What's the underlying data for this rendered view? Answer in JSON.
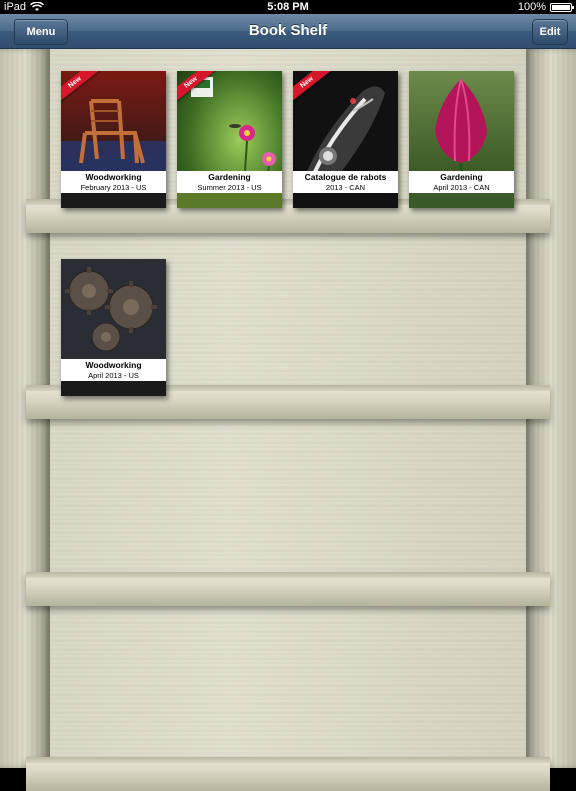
{
  "status_bar": {
    "device": "iPad",
    "time": "5:08 PM",
    "battery": "100%"
  },
  "navbar": {
    "title": "Book Shelf",
    "menu_label": "Menu",
    "edit_label": "Edit"
  },
  "books": [
    {
      "title": "Woodworking",
      "subtitle": "February 2013 - US",
      "badge": "New",
      "cover": "chair"
    },
    {
      "title": "Gardening",
      "subtitle": "Summer 2013 - US",
      "badge": "New",
      "cover": "garden-flowers"
    },
    {
      "title": "Catalogue de rabots",
      "subtitle": "2013 - CAN",
      "badge": "New",
      "cover": "plane-tool"
    },
    {
      "title": "Gardening",
      "subtitle": "April 2013 - CAN",
      "badge": "",
      "cover": "tulip"
    },
    {
      "title": "Woodworking",
      "subtitle": "April 2013 - US",
      "badge": "",
      "cover": "gears"
    }
  ]
}
